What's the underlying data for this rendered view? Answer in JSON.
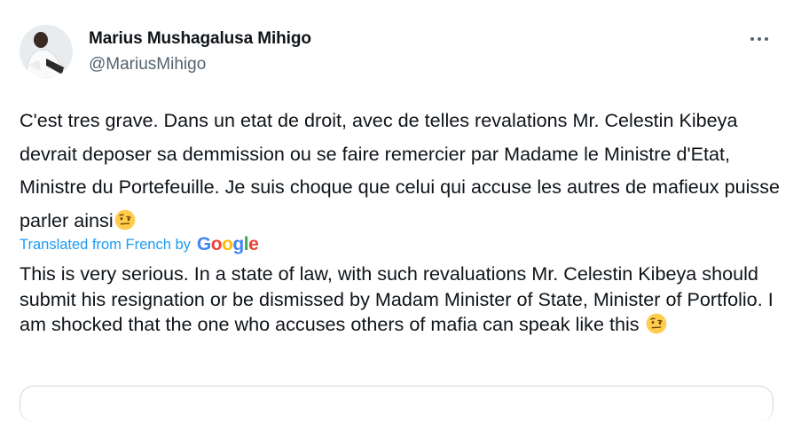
{
  "author": {
    "name": "Marius Mushagalusa Mihigo",
    "handle": "@MariusMihigo"
  },
  "icons": {
    "more": "more-horizontal-icon",
    "emoji": "face-with-raised-eyebrow-emoji"
  },
  "tweet": {
    "text": "C'est tres grave. Dans un etat de droit, avec de telles revalations Mr. Celestin Kibeya devrait deposer sa demmission ou se faire remercier par Madame le Ministre d'Etat, Ministre du Portefeuille. Je suis choque que celui qui accuse les autres de mafieux puisse parler ainsi"
  },
  "translation": {
    "label": "Translated from French by",
    "provider": "Google",
    "text": "This is very serious. In a state of law, with such revaluations Mr. Celestin Kibeya should submit his resignation or be dismissed by Madam Minister of State, Minister of Portfolio. I am shocked that the one who accuses others of mafia can speak like this"
  },
  "colors": {
    "text": "#0f1419",
    "secondary": "#536471",
    "link": "#1d9bf0",
    "border": "#cfd9de"
  }
}
